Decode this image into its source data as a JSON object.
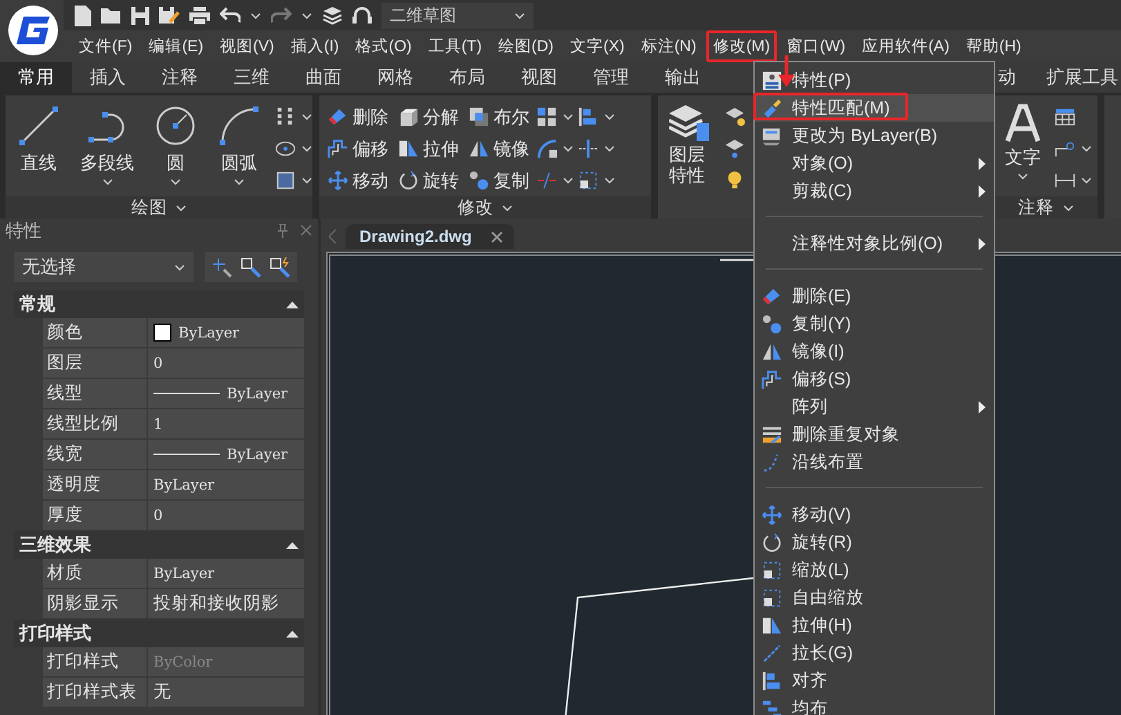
{
  "title_bar": {
    "workspace": "二维草图"
  },
  "menu_bar": [
    {
      "label": "文件(F)",
      "selected": false
    },
    {
      "label": "编辑(E)",
      "selected": false
    },
    {
      "label": "视图(V)",
      "selected": false
    },
    {
      "label": "插入(I)",
      "selected": false
    },
    {
      "label": "格式(O)",
      "selected": false
    },
    {
      "label": "工具(T)",
      "selected": false
    },
    {
      "label": "绘图(D)",
      "selected": false
    },
    {
      "label": "文字(X)",
      "selected": false
    },
    {
      "label": "标注(N)",
      "selected": false
    },
    {
      "label": "修改(M)",
      "selected": true
    },
    {
      "label": "窗口(W)",
      "selected": false
    },
    {
      "label": "应用软件(A)",
      "selected": false
    },
    {
      "label": "帮助(H)",
      "selected": false
    }
  ],
  "ribbon_tabs": [
    {
      "label": "常用",
      "selected": true
    },
    {
      "label": "插入",
      "selected": false
    },
    {
      "label": "注释",
      "selected": false
    },
    {
      "label": "三维",
      "selected": false
    },
    {
      "label": "曲面",
      "selected": false
    },
    {
      "label": "网格",
      "selected": false
    },
    {
      "label": "布局",
      "selected": false
    },
    {
      "label": "视图",
      "selected": false
    },
    {
      "label": "管理",
      "selected": false
    },
    {
      "label": "输出",
      "selected": false
    },
    {
      "label": "动",
      "selected": false
    },
    {
      "label": "扩展工具",
      "selected": false
    }
  ],
  "ribbon": {
    "draw_panel": {
      "title": "绘图",
      "buttons": [
        {
          "label": "直线",
          "dropdown": false
        },
        {
          "label": "多段线",
          "dropdown": true
        },
        {
          "label": "圆",
          "dropdown": true
        },
        {
          "label": "圆弧",
          "dropdown": true
        }
      ]
    },
    "modify_panel": {
      "title": "修改",
      "buttons": [
        "删除",
        "偏移",
        "移动",
        "分解",
        "拉伸",
        "旋转",
        "布尔",
        "镜像",
        "复制"
      ]
    },
    "layer_panel": {
      "button": "图层特性"
    },
    "annotation_panel": {
      "title": "注释",
      "button": "文字"
    }
  },
  "properties": {
    "title": "特性",
    "selection": "无选择",
    "sections": [
      {
        "title": "常规",
        "expanded": true,
        "rows": [
          {
            "label": "颜色",
            "value": "ByLayer",
            "kind": "swatch"
          },
          {
            "label": "图层",
            "value": "0",
            "kind": "text"
          },
          {
            "label": "线型",
            "value": "ByLayer",
            "kind": "line"
          },
          {
            "label": "线型比例",
            "value": "1",
            "kind": "text"
          },
          {
            "label": "线宽",
            "value": "ByLayer",
            "kind": "line"
          },
          {
            "label": "透明度",
            "value": "ByLayer",
            "kind": "text"
          },
          {
            "label": "厚度",
            "value": "0",
            "kind": "text"
          }
        ]
      },
      {
        "title": "三维效果",
        "expanded": true,
        "rows": [
          {
            "label": "材质",
            "value": "ByLayer",
            "kind": "text"
          },
          {
            "label": "阴影显示",
            "value": "投射和接收阴影",
            "kind": "text"
          }
        ]
      },
      {
        "title": "打印样式",
        "expanded": true,
        "rows": [
          {
            "label": "打印样式",
            "value": "ByColor",
            "kind": "muted"
          },
          {
            "label": "打印样式表",
            "value": "无",
            "kind": "text"
          }
        ]
      }
    ]
  },
  "document_tab": {
    "label": "Drawing2.dwg"
  },
  "context_menu": [
    {
      "kind": "command",
      "label": "特性(P)",
      "submenu": false,
      "selected": false
    },
    {
      "kind": "command",
      "label": "特性匹配(M)",
      "submenu": false,
      "selected": true
    },
    {
      "kind": "command",
      "label": "更改为 ByLayer(B)",
      "submenu": false,
      "selected": false
    },
    {
      "kind": "command",
      "label": "对象(O)",
      "submenu": true,
      "selected": false
    },
    {
      "kind": "command",
      "label": "剪裁(C)",
      "submenu": true,
      "selected": false
    },
    {
      "kind": "separator"
    },
    {
      "kind": "command",
      "label": "注释性对象比例(O)",
      "submenu": true,
      "selected": false
    },
    {
      "kind": "separator"
    },
    {
      "kind": "command",
      "label": "删除(E)",
      "submenu": false,
      "selected": false
    },
    {
      "kind": "command",
      "label": "复制(Y)",
      "submenu": false,
      "selected": false
    },
    {
      "kind": "command",
      "label": "镜像(I)",
      "submenu": false,
      "selected": false
    },
    {
      "kind": "command",
      "label": "偏移(S)",
      "submenu": false,
      "selected": false
    },
    {
      "kind": "command",
      "label": "阵列",
      "submenu": true,
      "selected": false
    },
    {
      "kind": "command",
      "label": "删除重复对象",
      "submenu": false,
      "selected": false
    },
    {
      "kind": "command",
      "label": "沿线布置",
      "submenu": false,
      "selected": false
    },
    {
      "kind": "separator"
    },
    {
      "kind": "command",
      "label": "移动(V)",
      "submenu": false,
      "selected": false
    },
    {
      "kind": "command",
      "label": "旋转(R)",
      "submenu": false,
      "selected": false
    },
    {
      "kind": "command",
      "label": "缩放(L)",
      "submenu": false,
      "selected": false
    },
    {
      "kind": "command",
      "label": "自由缩放",
      "submenu": false,
      "selected": false
    },
    {
      "kind": "command",
      "label": "拉伸(H)",
      "submenu": false,
      "selected": false
    },
    {
      "kind": "command",
      "label": "拉长(G)",
      "submenu": false,
      "selected": false
    },
    {
      "kind": "command",
      "label": "对齐",
      "submenu": false,
      "selected": false
    },
    {
      "kind": "command",
      "label": "均布",
      "submenu": false,
      "selected": false
    }
  ]
}
